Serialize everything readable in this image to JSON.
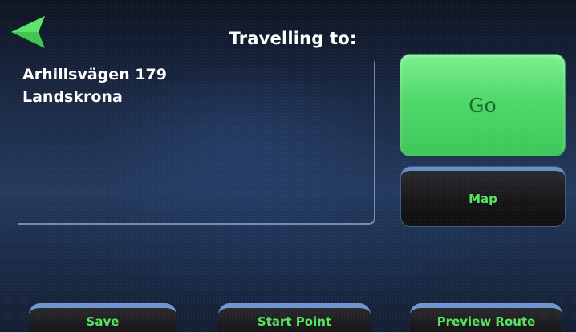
{
  "header": {
    "title": "Travelling to:"
  },
  "destination": {
    "street": "Arhillsvägen 179",
    "city": "Landskrona"
  },
  "actions": {
    "go_label": "Go",
    "map_label": "Map"
  },
  "toolbar": {
    "save_label": "Save",
    "start_point_label": "Start Point",
    "preview_route_label": "Preview Route"
  },
  "icons": {
    "back": "back-arrow-icon"
  },
  "colors": {
    "accent_green": "#57e45f",
    "go_button_green": "#5ad972",
    "button_border_blue": "#6f96d3",
    "background_navy": "#1c2c49"
  }
}
